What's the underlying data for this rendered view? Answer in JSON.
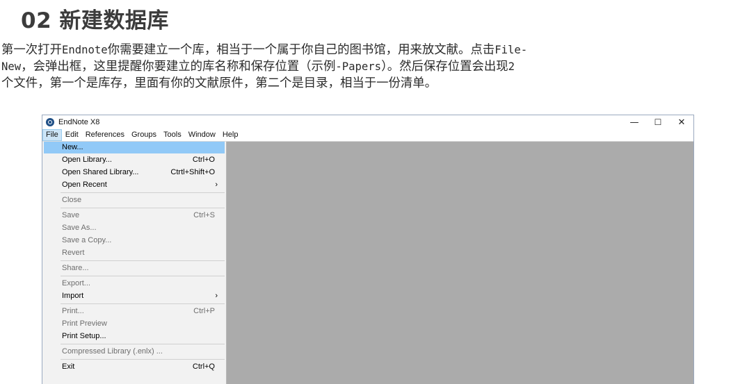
{
  "heading": "02 新建数据库",
  "paragraph": {
    "line1_a": "第一次打开",
    "line1_b": "Endnote",
    "line1_c": "你需要建立一个库，相当于一个属于你自己的图书馆，用来放文献。点击",
    "line1_d": "File-",
    "line2_a": "New",
    "line2_b": "，会弹出框，这里提醒你要建立的库名称和保存位置（示例",
    "line2_c": "-Papers",
    "line2_d": "）。然后保存位置会出现",
    "line2_e": "2",
    "line3": "个文件，第一个是库存，里面有你的文献原件，第二个是目录，相当于一份清单。"
  },
  "window": {
    "title": "EndNote X8",
    "icon": "endnote-logo-icon",
    "controls": {
      "minimize": "—",
      "maximize": "☐",
      "close": "✕"
    }
  },
  "menubar": [
    "File",
    "Edit",
    "References",
    "Groups",
    "Tools",
    "Window",
    "Help"
  ],
  "file_menu": [
    {
      "label": "New...",
      "shortcut": "",
      "highlighted": true,
      "enabled": true
    },
    {
      "label": "Open Library...",
      "shortcut": "Ctrl+O",
      "enabled": true
    },
    {
      "label": "Open Shared Library...",
      "shortcut": "Ctrtl+Shift+O",
      "enabled": true
    },
    {
      "label": "Open Recent",
      "shortcut": "›",
      "enabled": true
    },
    {
      "label": "Close",
      "shortcut": "",
      "enabled": false
    },
    {
      "label": "Save",
      "shortcut": "Ctrl+S",
      "enabled": false
    },
    {
      "label": "Save As...",
      "shortcut": "",
      "enabled": false
    },
    {
      "label": "Save a Copy...",
      "shortcut": "",
      "enabled": false
    },
    {
      "label": "Revert",
      "shortcut": "",
      "enabled": false
    },
    {
      "label": "Share...",
      "shortcut": "",
      "enabled": false
    },
    {
      "label": "Export...",
      "shortcut": "",
      "enabled": false
    },
    {
      "label": "Import",
      "shortcut": "›",
      "enabled": true
    },
    {
      "label": "Print...",
      "shortcut": "Ctrl+P",
      "enabled": false
    },
    {
      "label": "Print Preview",
      "shortcut": "",
      "enabled": false
    },
    {
      "label": "Print Setup...",
      "shortcut": "",
      "enabled": true
    },
    {
      "label": "Compressed Library (.enlx) ...",
      "shortcut": "",
      "enabled": false
    },
    {
      "label": "Exit",
      "shortcut": "Ctrl+Q",
      "enabled": true
    }
  ],
  "colors": {
    "highlight": "#91c9f7",
    "menu_bg": "#f2f2f2",
    "workspace": "#ababab",
    "disabled_text": "#6d6d6d"
  }
}
